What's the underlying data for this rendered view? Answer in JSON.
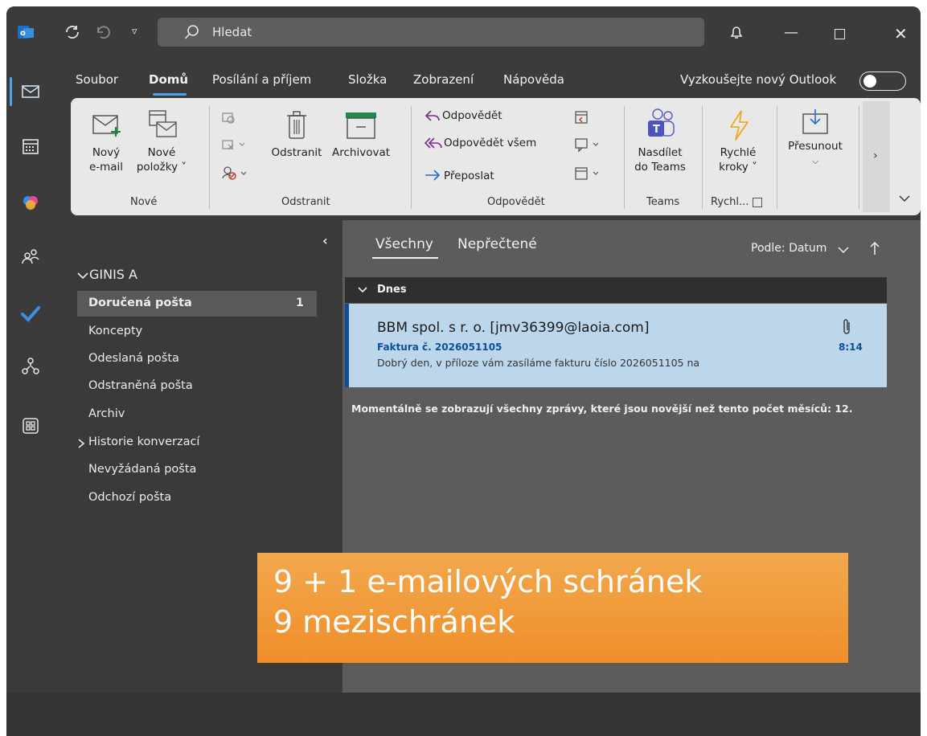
{
  "titlebar": {
    "search_placeholder": "Hledat",
    "icons": [
      "outlook-app-icon",
      "sync-icon",
      "undo-icon",
      "quick-access-dropdown-icon",
      "search-icon",
      "bell-icon",
      "minimize-icon",
      "maximize-icon",
      "close-icon"
    ]
  },
  "rail": [
    "mail-icon",
    "calendar-icon",
    "copilot-icon",
    "people-icon",
    "todo-icon",
    "org-icon",
    "apps-icon"
  ],
  "menu": {
    "tabs": [
      "Soubor",
      "Domů",
      "Posílání a příjem",
      "Složka",
      "Zobrazení",
      "Nápověda"
    ],
    "active": "Domů",
    "try_new": "Vyzkoušejte nový Outlook"
  },
  "ribbon": {
    "new_email": [
      "Nový",
      "e-mail"
    ],
    "new_items": [
      "Nové",
      "položky ˅"
    ],
    "delete": "Odstranit",
    "archive": "Archivovat",
    "reply": "Odpovědět",
    "reply_all": "Odpovědět všem",
    "forward": "Přeposlat",
    "teams": [
      "Nasdílet",
      "do Teams"
    ],
    "quick_steps": [
      "Rychlé",
      "kroky ˅"
    ],
    "move": "Přesunout",
    "groups": [
      "Nové",
      "Odstranit",
      "Odpovědět",
      "Teams",
      "Rychl..."
    ]
  },
  "folders": {
    "account": "GINIS A",
    "items": [
      {
        "label": "Doručená pošta",
        "count": "1"
      },
      {
        "label": "Koncepty"
      },
      {
        "label": "Odeslaná pošta"
      },
      {
        "label": "Odstraněná pošta"
      },
      {
        "label": "Archiv"
      },
      {
        "label": "Historie konverzací"
      },
      {
        "label": "Nevyžádaná pošta"
      },
      {
        "label": "Odchozí pošta"
      }
    ]
  },
  "list": {
    "tabs": [
      "Všechny",
      "Nepřečtené"
    ],
    "sort": "Podle: Datum",
    "group": "Dnes",
    "message": {
      "from": "BBM spol. s r. o. [jmv36399@laoia.com]",
      "subject": "Faktura č. 2026051105",
      "time": "8:14",
      "preview": "Dobrý den,  v příloze vám zasíláme fakturu číslo 2026051105 na"
    },
    "info": "Momentálně se zobrazují všechny zprávy, které jsou novější než tento počet měsíců: 12."
  },
  "banner": {
    "line1": "9 + 1 e-mailových schránek",
    "line2": "9 mezischránek"
  },
  "colors": {
    "accent": "#4aa3f5",
    "selected_message": "#bcd6ec",
    "banner": "#f08e2a"
  }
}
